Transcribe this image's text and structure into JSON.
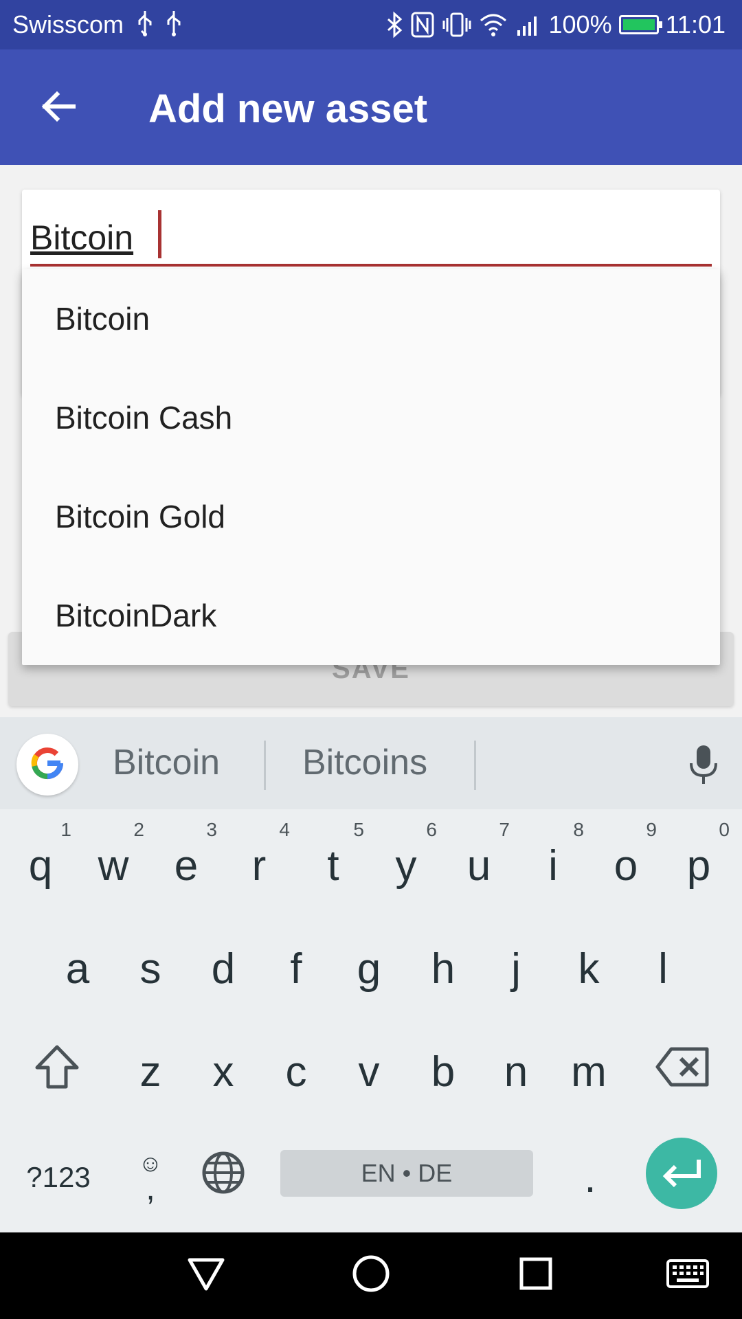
{
  "status_bar": {
    "carrier": "Swisscom",
    "usb_symbol": "⚲",
    "battery_percent": "100%",
    "battery_level": 1.0,
    "time": "11:01",
    "icons": [
      "usb-icon",
      "usb-icon",
      "bluetooth-icon",
      "nfc-icon",
      "vibrate-icon",
      "wifi-icon",
      "signal-icon",
      "battery-charging-icon"
    ]
  },
  "app_bar": {
    "title": "Add new asset",
    "back_icon": "arrow-back-icon"
  },
  "form": {
    "asset_input_value": "Bitcoin",
    "save_label": "SAVE"
  },
  "colors": {
    "app_bar": "#3f51b5",
    "status_bar": "#3143a0",
    "accent": "#a83232",
    "enter_key": "#3db8a4"
  },
  "suggestions": [
    {
      "label": "Bitcoin"
    },
    {
      "label": "Bitcoin Cash"
    },
    {
      "label": "Bitcoin Gold"
    },
    {
      "label": "BitcoinDark"
    }
  ],
  "keyboard": {
    "word_suggestions": [
      "Bitcoin",
      "Bitcoins"
    ],
    "row1": [
      {
        "key": "q",
        "num": "1"
      },
      {
        "key": "w",
        "num": "2"
      },
      {
        "key": "e",
        "num": "3"
      },
      {
        "key": "r",
        "num": "4"
      },
      {
        "key": "t",
        "num": "5"
      },
      {
        "key": "y",
        "num": "6"
      },
      {
        "key": "u",
        "num": "7"
      },
      {
        "key": "i",
        "num": "8"
      },
      {
        "key": "o",
        "num": "9"
      },
      {
        "key": "p",
        "num": "0"
      }
    ],
    "row2": [
      "a",
      "s",
      "d",
      "f",
      "g",
      "h",
      "j",
      "k",
      "l"
    ],
    "row3": [
      "z",
      "x",
      "c",
      "v",
      "b",
      "n",
      "m"
    ],
    "symbols_label": "?123",
    "emoji_label": "☺",
    "comma_label": ",",
    "space_label": "EN • DE",
    "period_label": "."
  }
}
